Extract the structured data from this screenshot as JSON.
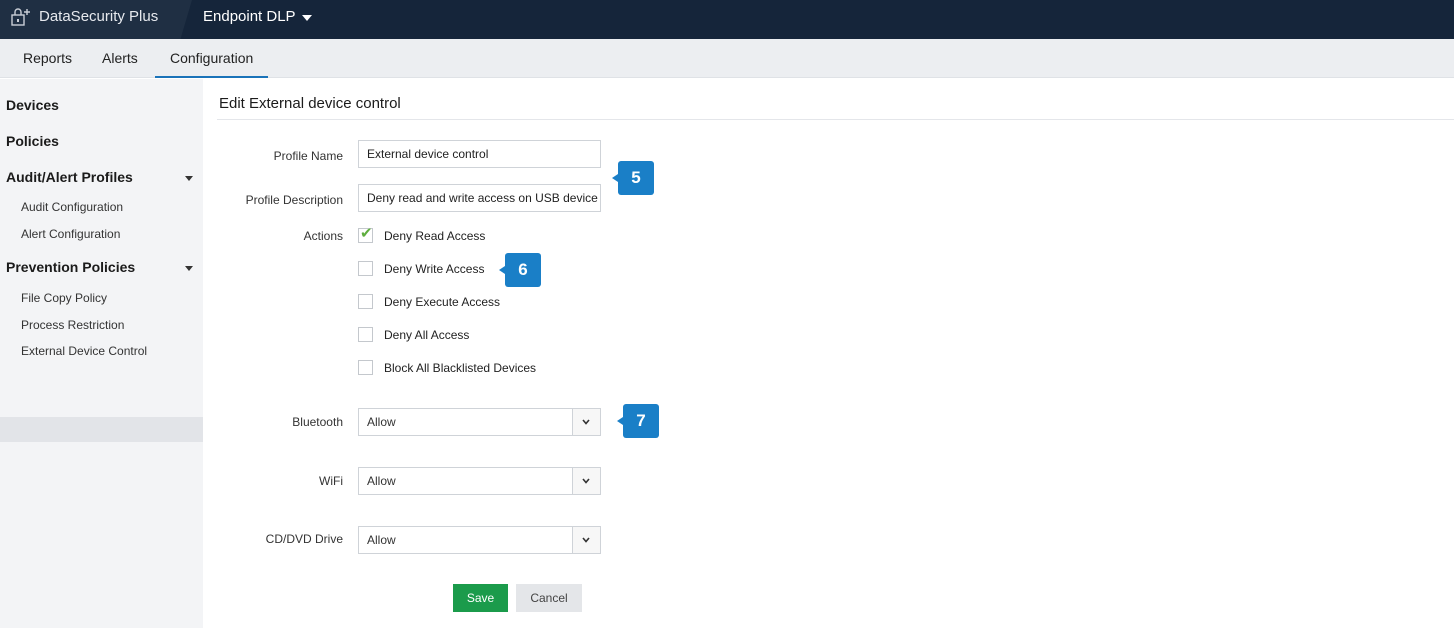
{
  "header": {
    "brand_name": "DataSecurity Plus",
    "product_name": "Endpoint DLP"
  },
  "tabs": [
    {
      "label": "Reports"
    },
    {
      "label": "Alerts"
    },
    {
      "label": "Configuration",
      "active": true
    }
  ],
  "sidebar": {
    "devices": "Devices",
    "policies": "Policies",
    "audit_alert_profiles": "Audit/Alert Profiles",
    "audit_configuration": "Audit Configuration",
    "alert_configuration": "Alert Configuration",
    "prevention_policies": "Prevention Policies",
    "file_copy_policy": "File Copy Policy",
    "process_restriction": "Process Restriction",
    "external_device_control": "External Device Control"
  },
  "form": {
    "title": "Edit External device control",
    "profile_name_label": "Profile Name",
    "profile_name_value": "External device control",
    "profile_description_label": "Profile Description",
    "profile_description_value": "Deny read and write access on USB device",
    "actions_label": "Actions",
    "actions": [
      {
        "label": "Deny Read Access",
        "checked": true
      },
      {
        "label": "Deny Write Access",
        "checked": false
      },
      {
        "label": "Deny Execute Access",
        "checked": false
      },
      {
        "label": "Deny All Access",
        "checked": false
      },
      {
        "label": "Block All Blacklisted Devices",
        "checked": false
      }
    ],
    "bluetooth_label": "Bluetooth",
    "bluetooth_value": "Allow",
    "wifi_label": "WiFi",
    "wifi_value": "Allow",
    "cddvd_label": "CD/DVD Drive",
    "cddvd_value": "Allow",
    "save_label": "Save",
    "cancel_label": "Cancel"
  },
  "callouts": {
    "c5": "5",
    "c6": "6",
    "c7": "7"
  },
  "colors": {
    "topbar": "#15253a",
    "accent": "#1a73b9",
    "save": "#1b9b4b",
    "callout": "#1a7fc7",
    "check": "#5fae3f"
  }
}
